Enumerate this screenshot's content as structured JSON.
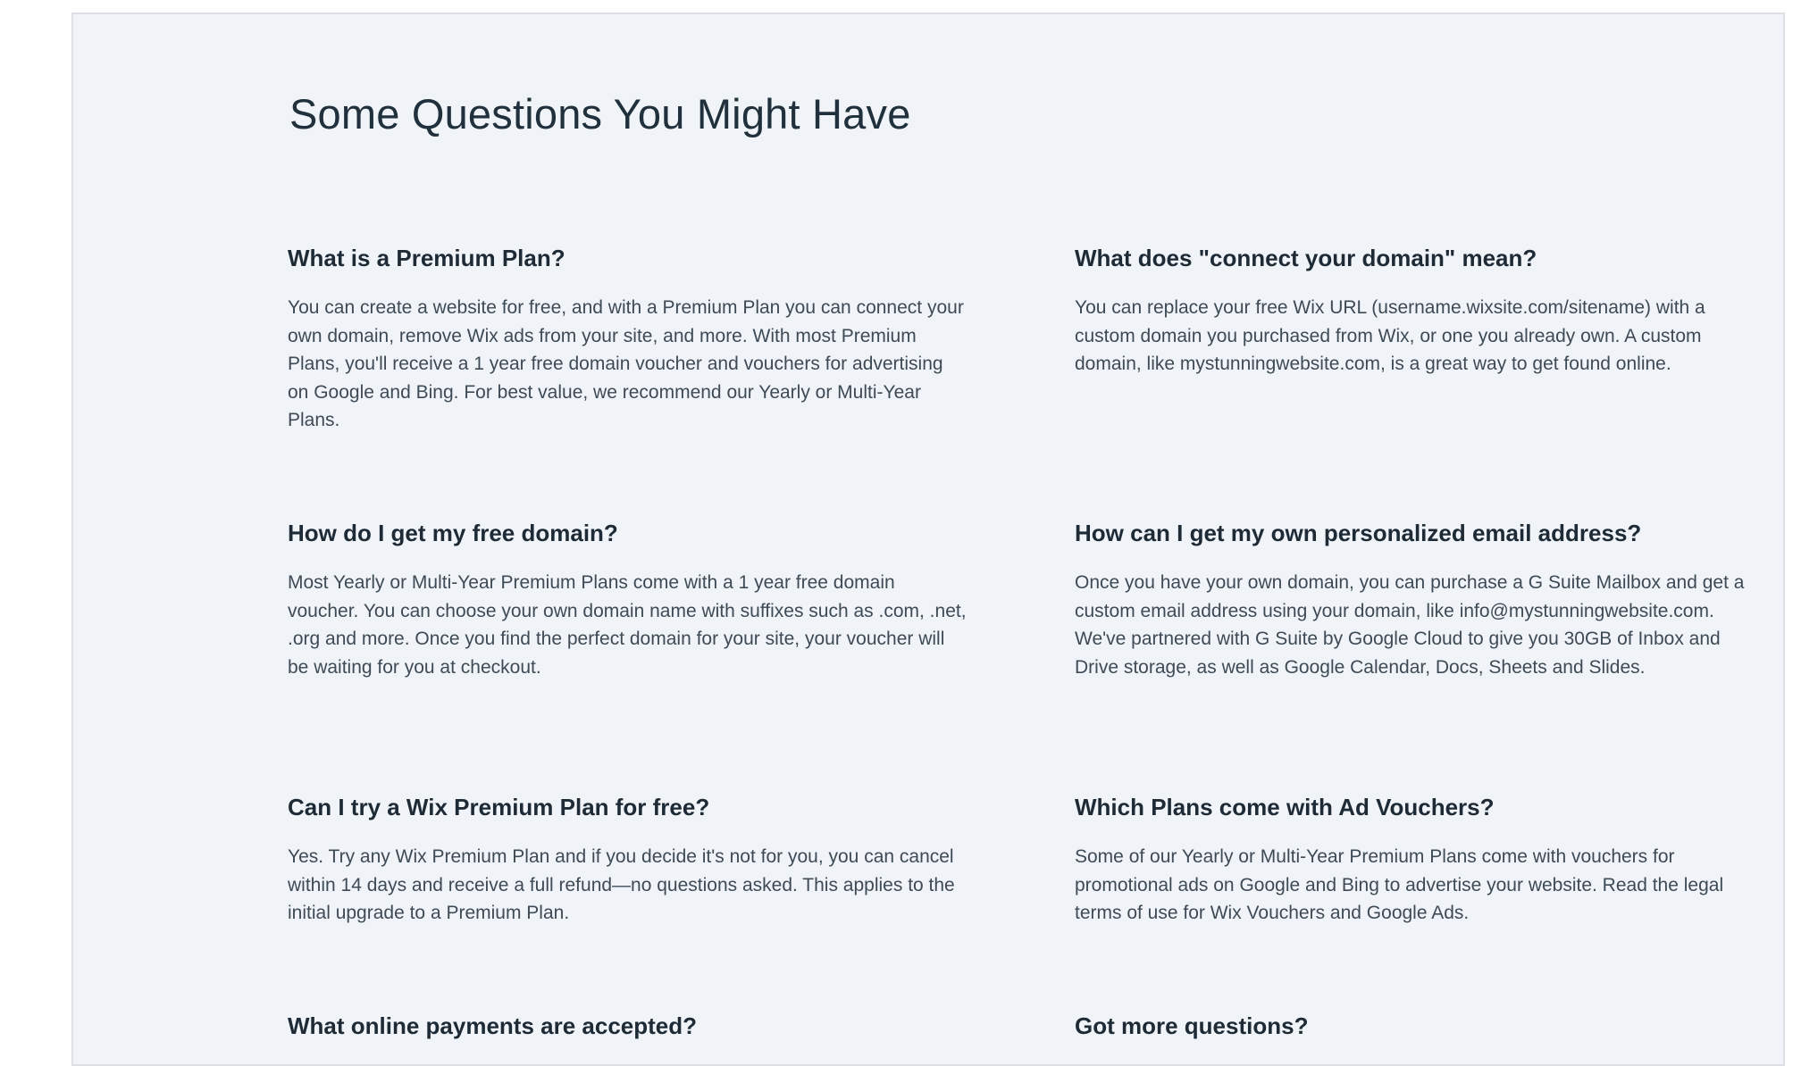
{
  "faq": {
    "title": "Some Questions You Might Have",
    "items": [
      {
        "question": "What is a Premium Plan?",
        "answer": "You can create a website for free, and with a Premium Plan you can connect your own domain, remove Wix ads from your site, and more. With most Premium Plans, you'll receive a 1 year free domain voucher and vouchers for advertising on Google and Bing. For best value, we recommend our Yearly or Multi-Year Plans."
      },
      {
        "question": "What does \"connect your domain\" mean?",
        "answer": "You can replace your free Wix URL (username.wixsite.com/sitename) with a custom domain you purchased from Wix, or one you already own. A custom domain, like mystunningwebsite.com, is a great way to get found online."
      },
      {
        "question": "How do I get my free domain?",
        "answer": "Most Yearly or Multi-Year Premium Plans come with a 1 year free domain voucher. You can choose your own domain name with suffixes such as .com, .net, .org and more. Once you find the perfect domain for your site, your voucher will be waiting for you at checkout."
      },
      {
        "question": "How can I get my own personalized email address?",
        "answer": "Once you have your own domain, you can purchase a G Suite Mailbox and get a custom email address using your domain, like info@mystunningwebsite.com. We've partnered with G Suite by Google Cloud to give you 30GB of Inbox and Drive storage, as well as Google Calendar, Docs, Sheets and Slides."
      },
      {
        "question": "Can I try a Wix Premium Plan for free?",
        "answer": "Yes. Try any Wix Premium Plan and if you decide it's not for you, you can cancel within 14 days and receive a full refund—no questions asked. This applies to the initial upgrade to a Premium Plan."
      },
      {
        "question": "Which Plans come with Ad Vouchers?",
        "answer": "Some of our Yearly or Multi-Year Premium Plans come with vouchers for promotional ads on Google and Bing to advertise your website. Read the legal terms of use for Wix Vouchers and Google Ads."
      },
      {
        "question": "What online payments are accepted?",
        "answer": ""
      },
      {
        "question": "Got more questions?",
        "answer": ""
      }
    ]
  }
}
